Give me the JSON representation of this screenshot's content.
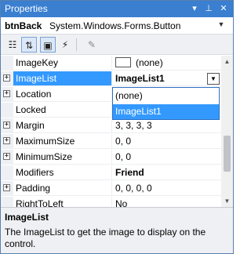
{
  "window": {
    "title": "Properties"
  },
  "object": {
    "name": "btnBack",
    "type": "System.Windows.Forms.Button"
  },
  "properties": [
    {
      "name": "ImageKey",
      "value": "(none)",
      "bold": false,
      "expandable": false,
      "swatch": true
    },
    {
      "name": "ImageList",
      "value": "ImageList1",
      "bold": true,
      "expandable": true,
      "selected": true,
      "dropdown": true
    },
    {
      "name": "Location",
      "value": "",
      "bold": false,
      "expandable": true
    },
    {
      "name": "Locked",
      "value": "",
      "bold": false,
      "expandable": false
    },
    {
      "name": "Margin",
      "value": "3, 3, 3, 3",
      "bold": false,
      "expandable": true
    },
    {
      "name": "MaximumSize",
      "value": "0, 0",
      "bold": false,
      "expandable": true
    },
    {
      "name": "MinimumSize",
      "value": "0, 0",
      "bold": false,
      "expandable": true
    },
    {
      "name": "Modifiers",
      "value": "Friend",
      "bold": true,
      "expandable": false
    },
    {
      "name": "Padding",
      "value": "0, 0, 0, 0",
      "bold": false,
      "expandable": true
    },
    {
      "name": "RightToLeft",
      "value": "No",
      "bold": false,
      "expandable": false
    }
  ],
  "dropdown_options": [
    "(none)",
    "ImageList1"
  ],
  "dropdown_selected": "ImageList1",
  "description": {
    "title": "ImageList",
    "text": "The ImageList to get the image to display on the control."
  },
  "colors": {
    "titlebar": "#3a7fd0",
    "selection": "#3399ff"
  }
}
